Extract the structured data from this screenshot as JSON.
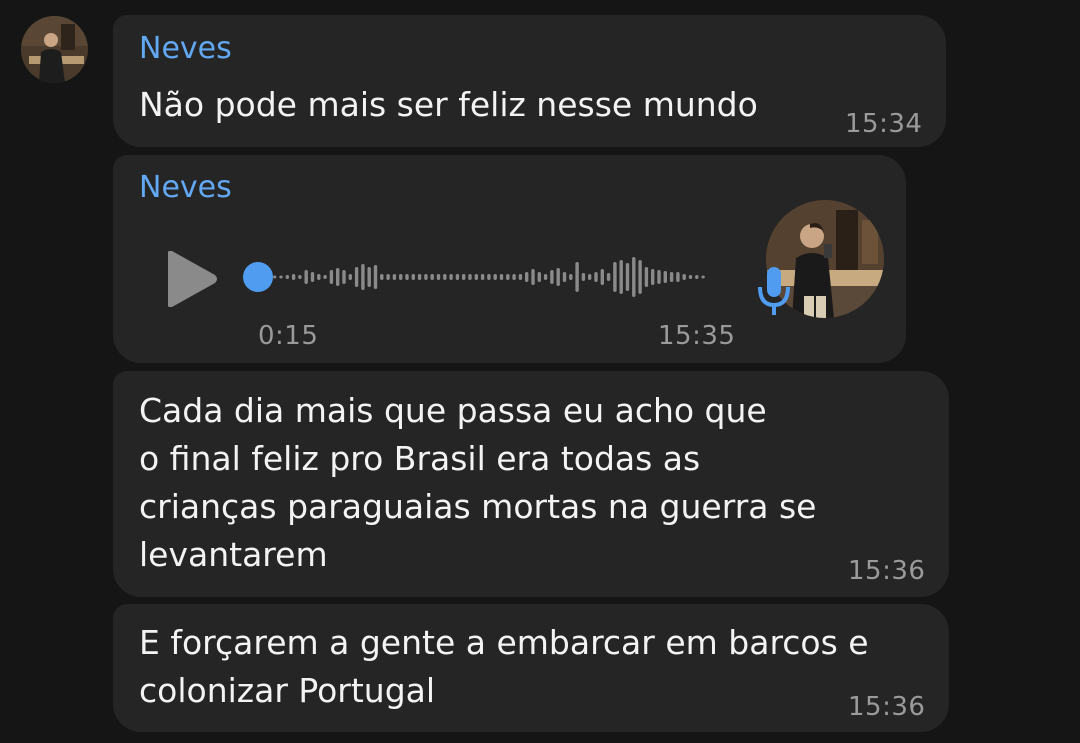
{
  "chat": {
    "messages": [
      {
        "sender": "Neves",
        "text": "Não pode mais ser feliz nesse mundo",
        "time": "15:34"
      },
      {
        "sender": "Neves",
        "type": "voice",
        "duration": "0:15",
        "time": "15:35",
        "progress": 0,
        "icons": [
          "play-icon",
          "microphone-icon"
        ]
      },
      {
        "text": "Cada dia mais que passa eu acho que\no final feliz pro Brasil era todas as\ncrianças paraguaias mortas na guerra se\nlevantarem",
        "time": "15:36"
      },
      {
        "text": "E forçarem a gente a embarcar em barcos e\ncolonizar Portugal",
        "time": "15:36"
      }
    ]
  },
  "colors": {
    "background": "#151515",
    "bubble": "#252525",
    "sender_name": "#62a8f2",
    "accent": "#4f9cf0",
    "timestamp": "#9a9a9a"
  }
}
